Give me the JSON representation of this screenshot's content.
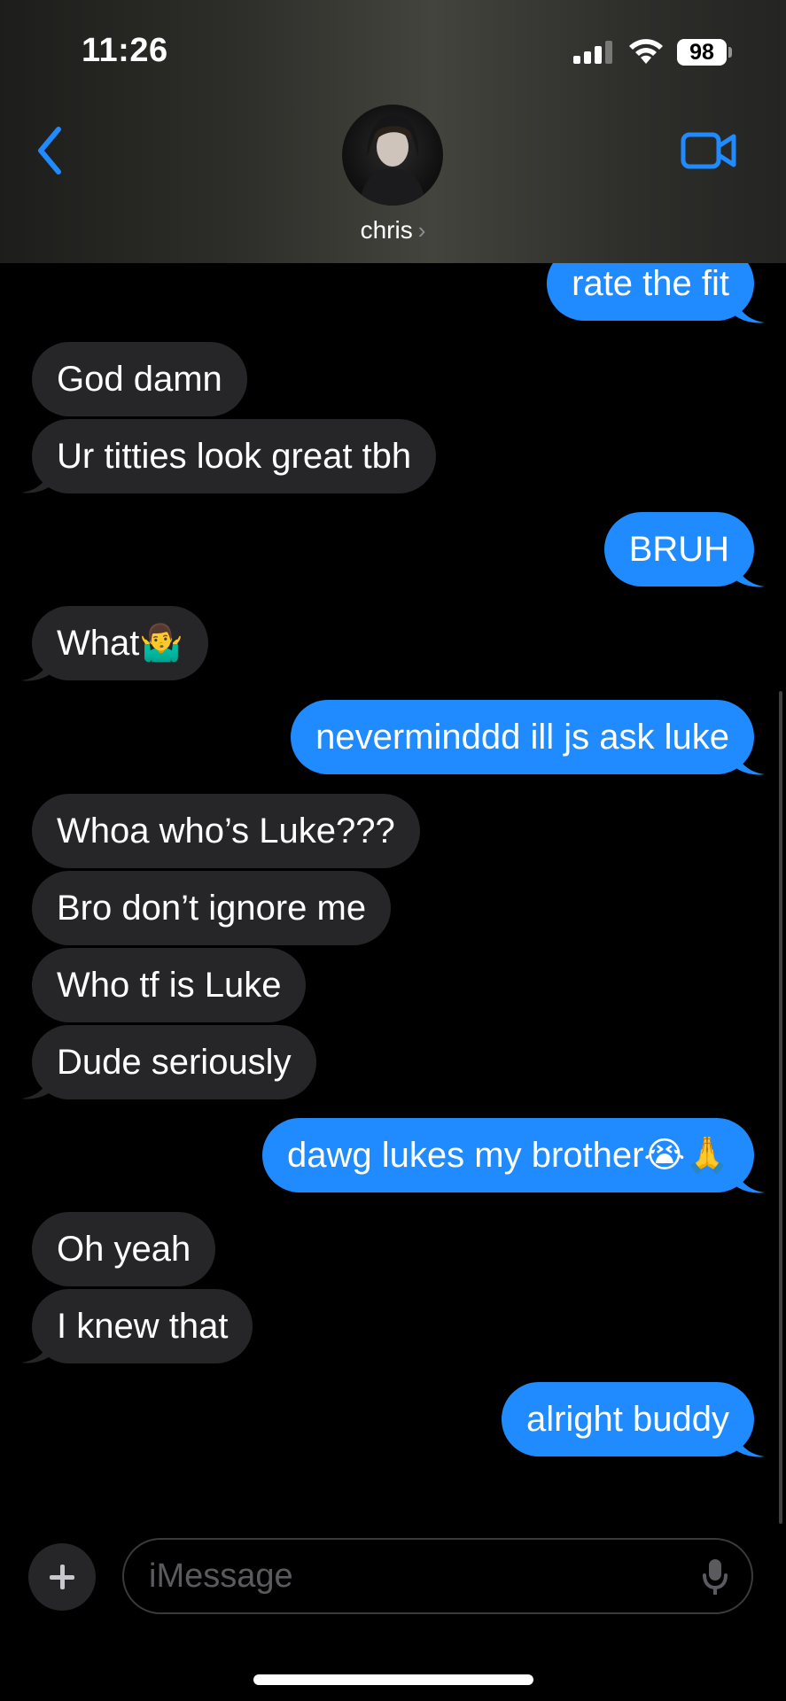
{
  "status_bar": {
    "time": "11:26",
    "battery": "98"
  },
  "header": {
    "contact_name": "chris"
  },
  "messages": [
    {
      "dir": "out",
      "text": "rate the fit"
    },
    {
      "dir": "in",
      "text": "God damn"
    },
    {
      "dir": "in",
      "text": "Ur titties look great tbh"
    },
    {
      "dir": "out",
      "text": "BRUH"
    },
    {
      "dir": "in",
      "text": "What🤷‍♂️"
    },
    {
      "dir": "out",
      "text": "neverminddd ill js ask luke"
    },
    {
      "dir": "in",
      "text": "Whoa who’s Luke???"
    },
    {
      "dir": "in",
      "text": "Bro don’t ignore me"
    },
    {
      "dir": "in",
      "text": "Who tf is Luke"
    },
    {
      "dir": "in",
      "text": "Dude seriously"
    },
    {
      "dir": "out",
      "text": "dawg lukes my brother😭🙏"
    },
    {
      "dir": "in",
      "text": "Oh yeah"
    },
    {
      "dir": "in",
      "text": "I knew that"
    },
    {
      "dir": "out",
      "text": "alright buddy"
    }
  ],
  "composer": {
    "placeholder": "iMessage"
  },
  "colors": {
    "outgoing": "#1f8bff",
    "incoming": "#262628",
    "accent": "#1f8bff"
  }
}
